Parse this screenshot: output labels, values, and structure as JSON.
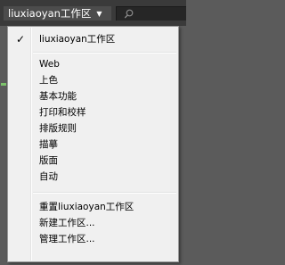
{
  "topbar": {
    "workspace_name": "liuxiaoyan工作区",
    "chevron_icon": "chevron-down-icon",
    "search_icon": "search-icon"
  },
  "menu": {
    "current_workspace": {
      "label": "liuxiaoyan工作区",
      "checked": true
    },
    "presets": [
      "Web",
      "上色",
      "基本功能",
      "打印和校样",
      "排版规则",
      "描摹",
      "版面",
      "自动"
    ],
    "actions": [
      "重置liuxiaoyan工作区",
      "新建工作区...",
      "管理工作区..."
    ]
  },
  "colors": {
    "topbar_bg": "#3a3a3a",
    "menu_bg": "#f0f0f0",
    "menu_border": "#979797"
  }
}
